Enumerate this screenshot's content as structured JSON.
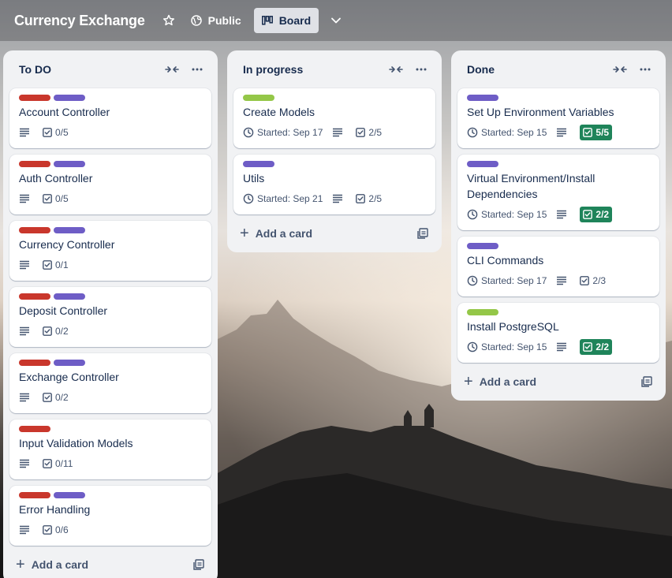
{
  "board": {
    "title": "Currency Exchange",
    "visibility_label": "Public",
    "view_label": "Board"
  },
  "colors": {
    "red": "#c9372c",
    "purple": "#6e5dc6",
    "green": "#94c748",
    "complete_green": "#1f845a"
  },
  "icons": {
    "star": "star-icon",
    "globe": "globe-icon",
    "board": "board-icon",
    "chevron": "chevron-down-icon",
    "collapse": "collapse-icon",
    "more": "more-icon",
    "description": "description-icon",
    "checklist": "checklist-icon",
    "clock": "clock-icon",
    "template": "template-icon"
  },
  "add_card_label": "Add a card",
  "lists": [
    {
      "title": "To DO",
      "cards": [
        {
          "title": "Account Controller",
          "labels": [
            "red",
            "purple"
          ],
          "started": "",
          "checklist": "0/5",
          "complete": false
        },
        {
          "title": "Auth Controller",
          "labels": [
            "red",
            "purple"
          ],
          "started": "",
          "checklist": "0/5",
          "complete": false
        },
        {
          "title": "Currency Controller",
          "labels": [
            "red",
            "purple"
          ],
          "started": "",
          "checklist": "0/1",
          "complete": false
        },
        {
          "title": "Deposit Controller",
          "labels": [
            "red",
            "purple"
          ],
          "started": "",
          "checklist": "0/2",
          "complete": false
        },
        {
          "title": "Exchange Controller",
          "labels": [
            "red",
            "purple"
          ],
          "started": "",
          "checklist": "0/2",
          "complete": false
        },
        {
          "title": "Input Validation Models",
          "labels": [
            "red"
          ],
          "started": "",
          "checklist": "0/11",
          "complete": false
        },
        {
          "title": "Error Handling",
          "labels": [
            "red",
            "purple"
          ],
          "started": "",
          "checklist": "0/6",
          "complete": false
        }
      ]
    },
    {
      "title": "In progress",
      "cards": [
        {
          "title": "Create Models",
          "labels": [
            "green"
          ],
          "started": "Started: Sep 17",
          "checklist": "2/5",
          "complete": false
        },
        {
          "title": "Utils",
          "labels": [
            "purple"
          ],
          "started": "Started: Sep 21",
          "checklist": "2/5",
          "complete": false
        }
      ]
    },
    {
      "title": "Done",
      "cards": [
        {
          "title": "Set Up Environment Variables",
          "labels": [
            "purple"
          ],
          "started": "Started: Sep 15",
          "checklist": "5/5",
          "complete": true
        },
        {
          "title": "Virtual Environment/Install Dependencies",
          "labels": [
            "purple"
          ],
          "started": "Started: Sep 15",
          "checklist": "2/2",
          "complete": true
        },
        {
          "title": "CLI Commands",
          "labels": [
            "purple"
          ],
          "started": "Started: Sep 17",
          "checklist": "2/3",
          "complete": false
        },
        {
          "title": "Install PostgreSQL",
          "labels": [
            "green"
          ],
          "started": "Started: Sep 15",
          "checklist": "2/2",
          "complete": true
        }
      ]
    }
  ]
}
